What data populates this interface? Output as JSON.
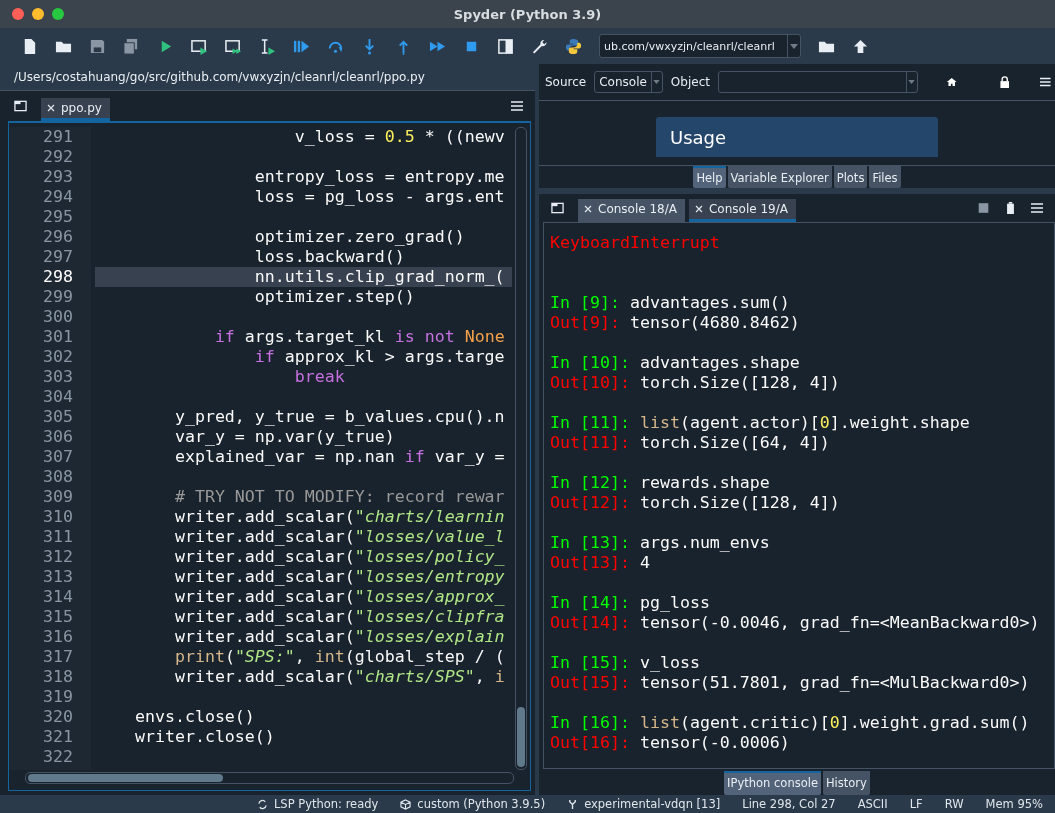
{
  "window": {
    "title": "Spyder (Python 3.9)"
  },
  "toolbar": {
    "path_field": {
      "value": "ub.com/vwxyzjn/cleanrl/cleanrl"
    }
  },
  "editor": {
    "file_path": "/Users/costahuang/go/src/github.com/vwxyzjn/cleanrl/cleanrl/ppo.py",
    "tabs": [
      {
        "label": "ppo.py",
        "selected": true
      }
    ],
    "lines": [
      {
        "n": "291",
        "current": false,
        "tokens": [
          {
            "kind": "plain",
            "text": "                    v_loss = "
          },
          {
            "kind": "number",
            "text": "0.5"
          },
          {
            "kind": "plain",
            "text": " * ((newv"
          }
        ]
      },
      {
        "n": "292",
        "current": false
      },
      {
        "n": "293",
        "current": false,
        "tokens": [
          {
            "kind": "plain",
            "text": "                entropy_loss = entropy.me"
          }
        ]
      },
      {
        "n": "294",
        "current": false,
        "tokens": [
          {
            "kind": "plain",
            "text": "                loss = pg_loss - args.ent"
          }
        ]
      },
      {
        "n": "295",
        "current": false
      },
      {
        "n": "296",
        "current": false,
        "tokens": [
          {
            "kind": "plain",
            "text": "                optimizer.zero_grad()"
          }
        ]
      },
      {
        "n": "297",
        "current": false,
        "tokens": [
          {
            "kind": "plain",
            "text": "                loss.backward()"
          }
        ]
      },
      {
        "n": "298",
        "current": true,
        "tokens": [
          {
            "kind": "plain",
            "text": "                nn.utils.clip_grad_norm_("
          }
        ]
      },
      {
        "n": "299",
        "current": false,
        "tokens": [
          {
            "kind": "plain",
            "text": "                optimizer.step()"
          }
        ]
      },
      {
        "n": "300",
        "current": false
      },
      {
        "n": "301",
        "current": false,
        "tokens": [
          {
            "kind": "keyword",
            "text": "            if"
          },
          {
            "kind": "plain",
            "text": " args.target_kl "
          },
          {
            "kind": "keyword",
            "text": "is not "
          },
          {
            "kind": "constant",
            "text": "None"
          }
        ]
      },
      {
        "n": "302",
        "current": false,
        "tokens": [
          {
            "kind": "keyword",
            "text": "                if"
          },
          {
            "kind": "plain",
            "text": " approx_kl > args.targe"
          }
        ]
      },
      {
        "n": "303",
        "current": false,
        "tokens": [
          {
            "kind": "keyword",
            "text": "                    break"
          }
        ]
      },
      {
        "n": "304",
        "current": false
      },
      {
        "n": "305",
        "current": false,
        "tokens": [
          {
            "kind": "plain",
            "text": "        y_pred, y_true = b_values.cpu().n"
          }
        ]
      },
      {
        "n": "306",
        "current": false,
        "tokens": [
          {
            "kind": "plain",
            "text": "        var_y = np.var(y_true)"
          }
        ]
      },
      {
        "n": "307",
        "current": false,
        "tokens": [
          {
            "kind": "plain",
            "text": "        explained_var = np.nan "
          },
          {
            "kind": "keyword",
            "text": "if"
          },
          {
            "kind": "plain",
            "text": " var_y ="
          }
        ]
      },
      {
        "n": "308",
        "current": false
      },
      {
        "n": "309",
        "current": false,
        "tokens": [
          {
            "kind": "comment",
            "text": "        # TRY NOT TO MODIFY: record rewar"
          }
        ]
      },
      {
        "n": "310",
        "current": false,
        "tokens": [
          {
            "kind": "plain",
            "text": "        writer.add_scalar("
          },
          {
            "kind": "string",
            "text": "\"charts/learnin"
          }
        ]
      },
      {
        "n": "311",
        "current": false,
        "tokens": [
          {
            "kind": "plain",
            "text": "        writer.add_scalar("
          },
          {
            "kind": "string",
            "text": "\"losses/value_l"
          }
        ]
      },
      {
        "n": "312",
        "current": false,
        "tokens": [
          {
            "kind": "plain",
            "text": "        writer.add_scalar("
          },
          {
            "kind": "string",
            "text": "\"losses/policy_"
          }
        ]
      },
      {
        "n": "313",
        "current": false,
        "tokens": [
          {
            "kind": "plain",
            "text": "        writer.add_scalar("
          },
          {
            "kind": "string",
            "text": "\"losses/entropy"
          }
        ]
      },
      {
        "n": "314",
        "current": false,
        "tokens": [
          {
            "kind": "plain",
            "text": "        writer.add_scalar("
          },
          {
            "kind": "string",
            "text": "\"losses/approx_"
          }
        ]
      },
      {
        "n": "315",
        "current": false,
        "tokens": [
          {
            "kind": "plain",
            "text": "        writer.add_scalar("
          },
          {
            "kind": "string",
            "text": "\"losses/clipfra"
          }
        ]
      },
      {
        "n": "316",
        "current": false,
        "tokens": [
          {
            "kind": "plain",
            "text": "        writer.add_scalar("
          },
          {
            "kind": "string",
            "text": "\"losses/explain"
          }
        ]
      },
      {
        "n": "317",
        "current": false,
        "tokens": [
          {
            "kind": "builtin",
            "text": "        print"
          },
          {
            "kind": "plain",
            "text": "("
          },
          {
            "kind": "string",
            "text": "\"SPS:\""
          },
          {
            "kind": "plain",
            "text": ", "
          },
          {
            "kind": "builtin",
            "text": "int"
          },
          {
            "kind": "plain",
            "text": "(global_step / ("
          }
        ]
      },
      {
        "n": "318",
        "current": false,
        "tokens": [
          {
            "kind": "plain",
            "text": "        writer.add_scalar("
          },
          {
            "kind": "string",
            "text": "\"charts/SPS\""
          },
          {
            "kind": "plain",
            "text": ", "
          },
          {
            "kind": "builtin",
            "text": "i"
          }
        ]
      },
      {
        "n": "319",
        "current": false
      },
      {
        "n": "320",
        "current": false,
        "tokens": [
          {
            "kind": "plain",
            "text": "    envs.close()"
          }
        ]
      },
      {
        "n": "321",
        "current": false,
        "tokens": [
          {
            "kind": "plain",
            "text": "    writer.close()"
          }
        ]
      },
      {
        "n": "322",
        "current": false
      }
    ]
  },
  "help": {
    "source_label": "Source",
    "source_value": "Console",
    "object_label": "Object",
    "usage_title": "Usage",
    "tabs": [
      {
        "label": "Help",
        "selected": true
      },
      {
        "label": "Variable Explorer",
        "selected": false
      },
      {
        "label": "Plots",
        "selected": false
      },
      {
        "label": "Files",
        "selected": false
      }
    ]
  },
  "console": {
    "tabs": [
      {
        "label": "Console 18/A",
        "selected": false
      },
      {
        "label": "Console 19/A",
        "selected": true
      }
    ],
    "entries": [
      {
        "kind": "error",
        "text": "KeyboardInterrupt"
      },
      {
        "kind": "input",
        "prompt": "In [9]:",
        "tokens": [
          {
            "kind": "plain",
            "text": "advantages.sum()"
          }
        ]
      },
      {
        "kind": "output",
        "prompt": "Out[9]:",
        "text": "tensor(4680.8462)"
      },
      {
        "kind": "input",
        "prompt": "In [10]:",
        "tokens": [
          {
            "kind": "plain",
            "text": "advantages.shape"
          }
        ]
      },
      {
        "kind": "output",
        "prompt": "Out[10]:",
        "text": "torch.Size([128, 4])"
      },
      {
        "kind": "input",
        "prompt": "In [11]:",
        "tokens": [
          {
            "kind": "builtin",
            "text": "list"
          },
          {
            "kind": "plain",
            "text": "(agent.actor)["
          },
          {
            "kind": "number",
            "text": "0"
          },
          {
            "kind": "plain",
            "text": "].weight.shape"
          }
        ]
      },
      {
        "kind": "output",
        "prompt": "Out[11]:",
        "text": "torch.Size([64, 4])"
      },
      {
        "kind": "input",
        "prompt": "In [12]:",
        "tokens": [
          {
            "kind": "plain",
            "text": "rewards.shape"
          }
        ]
      },
      {
        "kind": "output",
        "prompt": "Out[12]:",
        "text": "torch.Size([128, 4])"
      },
      {
        "kind": "input",
        "prompt": "In [13]:",
        "tokens": [
          {
            "kind": "plain",
            "text": "args.num_envs"
          }
        ]
      },
      {
        "kind": "output",
        "prompt": "Out[13]:",
        "text": "4"
      },
      {
        "kind": "input",
        "prompt": "In [14]:",
        "tokens": [
          {
            "kind": "plain",
            "text": "pg_loss"
          }
        ]
      },
      {
        "kind": "output",
        "prompt": "Out[14]:",
        "text": "tensor(-0.0046, grad_fn=<MeanBackward0>)"
      },
      {
        "kind": "input",
        "prompt": "In [15]:",
        "tokens": [
          {
            "kind": "plain",
            "text": "v_loss"
          }
        ]
      },
      {
        "kind": "output",
        "prompt": "Out[15]:",
        "text": "tensor(51.7801, grad_fn=<MulBackward0>)"
      },
      {
        "kind": "input",
        "prompt": "In [16]:",
        "tokens": [
          {
            "kind": "builtin",
            "text": "list"
          },
          {
            "kind": "plain",
            "text": "(agent.critic)["
          },
          {
            "kind": "number",
            "text": "0"
          },
          {
            "kind": "plain",
            "text": "].weight.grad.sum()"
          }
        ]
      },
      {
        "kind": "output",
        "prompt": "Out[16]:",
        "text": "tensor(-0.0006)"
      }
    ],
    "bottom_tabs": [
      {
        "label": "IPython console",
        "selected": true
      },
      {
        "label": "History",
        "selected": false
      }
    ]
  },
  "status_bar": [
    {
      "kind": "lsp",
      "text": "LSP Python: ready"
    },
    {
      "kind": "env",
      "text": "custom (Python 3.9.5)"
    },
    {
      "kind": "branch",
      "text": "experimental-vdqn [13]"
    },
    {
      "kind": "plain",
      "text": "Line 298, Col 27"
    },
    {
      "kind": "plain",
      "text": "ASCII"
    },
    {
      "kind": "plain",
      "text": "LF"
    },
    {
      "kind": "plain",
      "text": "RW"
    },
    {
      "kind": "plain",
      "text": "Mem 95%"
    }
  ]
}
